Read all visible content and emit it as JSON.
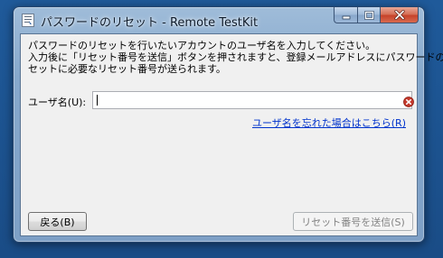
{
  "window": {
    "title": "パスワードのリセット - Remote TestKit"
  },
  "caption": {
    "minimize_icon": "minimize-icon",
    "maximize_icon": "maximize-icon",
    "close_icon": "close-icon"
  },
  "instructions": [
    "パスワードのリセットを行いたいアカウントのユーザ名を入力してください。",
    "入力後に「リセット番号を送信」ボタンを押されますと、登録メールアドレスにパスワードのリ",
    "セットに必要なリセット番号が送られます。"
  ],
  "username": {
    "label": "ユーザ名(U):",
    "value": "",
    "error_icon": "error-icon"
  },
  "forgot_link": "ユーザ名を忘れた場合はこちら(R)",
  "buttons": {
    "back_label": "戻る(B)",
    "send_label": "リセット番号を送信(S)"
  },
  "colors": {
    "link": "#0033cc",
    "error": "#c4392c",
    "disabled_text": "#838383"
  }
}
